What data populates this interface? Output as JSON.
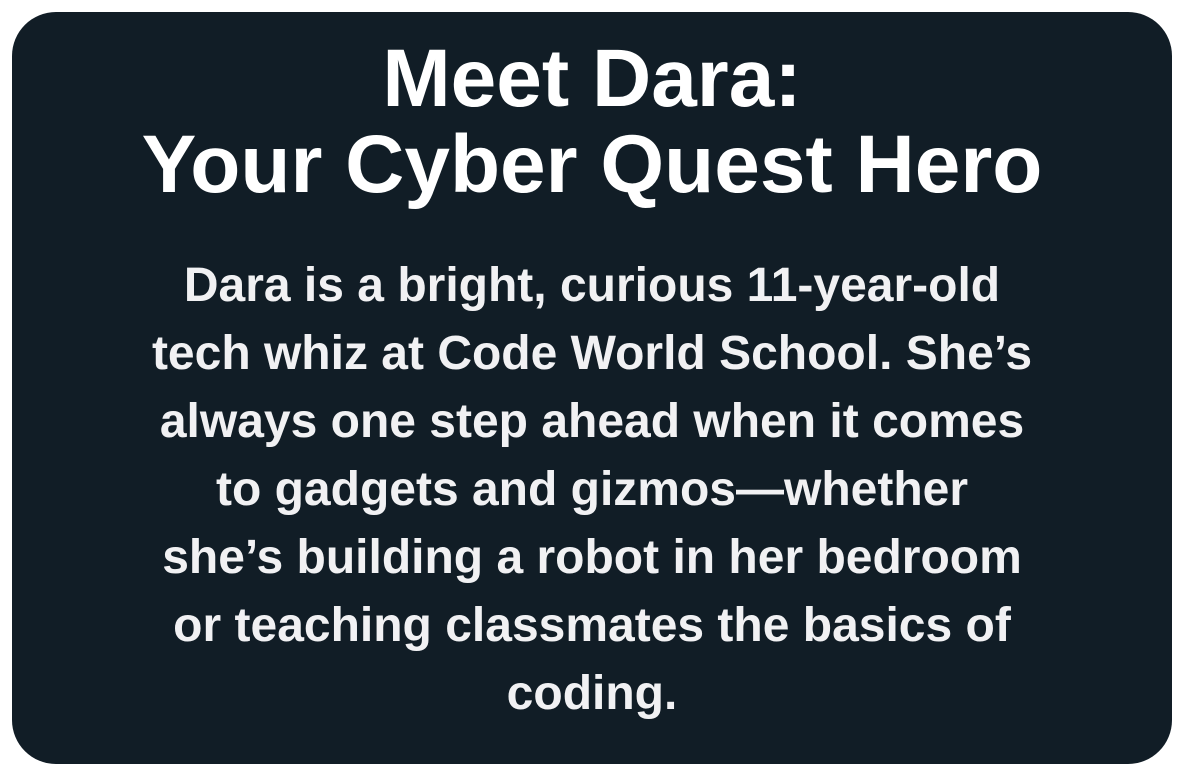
{
  "card": {
    "title_lines": [
      "Meet Dara:",
      "Your Cyber Quest Hero"
    ],
    "body_lines": [
      "Dara is a bright, curious 11-year-old",
      "tech whiz at Code World School. She’s",
      "always one step ahead when it comes",
      "to gadgets and gizmos—whether",
      "she’s building a robot in her bedroom",
      "or teaching classmates the basics of",
      "coding."
    ],
    "colors": {
      "background": "#111d26",
      "title": "#ffffff",
      "body": "#f1f1f3"
    }
  }
}
